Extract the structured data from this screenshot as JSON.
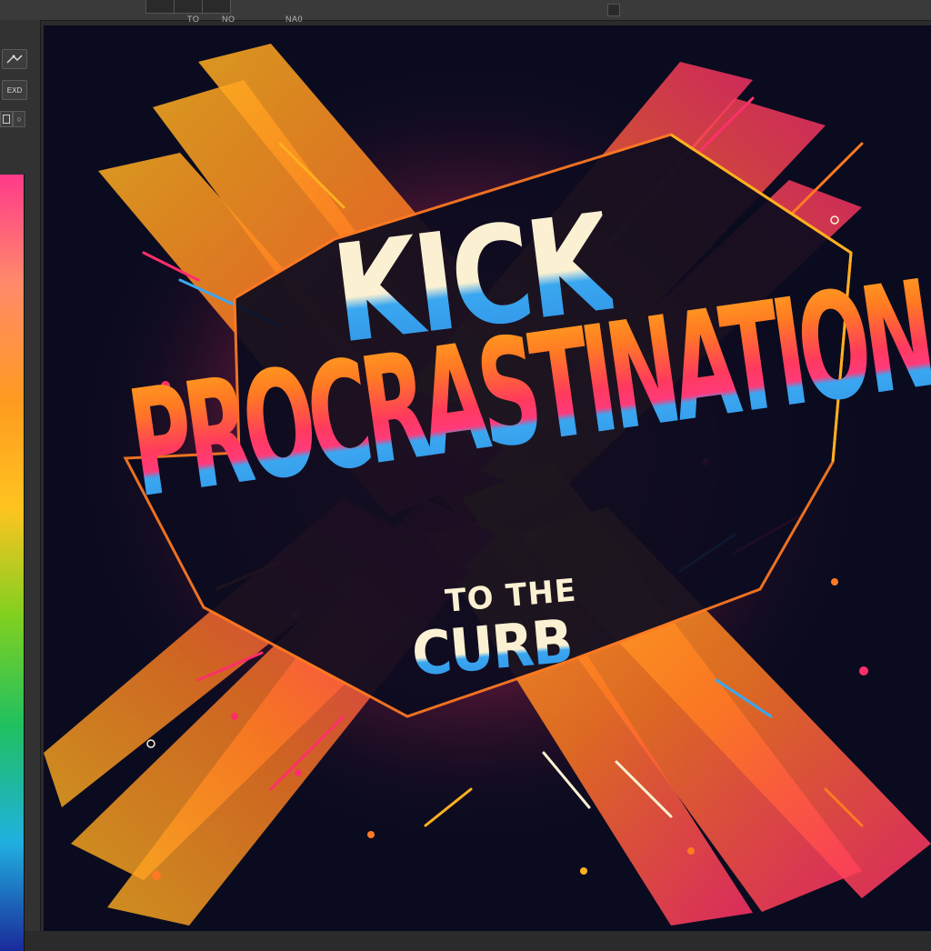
{
  "toolbar": {
    "label_a": "TO",
    "label_b": "NO",
    "label_c": "NA0"
  },
  "tools": {
    "expand_label": "EXD",
    "circle_glyph": "○"
  },
  "icons": {
    "path_tool": "pen-path-icon",
    "rect_mini": "rectangle-icon",
    "circle_mini": "circle-icon"
  },
  "artwork": {
    "line1": "KICK",
    "line2": "PROCRASTINATION",
    "line3": "TO THE",
    "line4": "CURB"
  },
  "palette": {
    "background": "#0b0b1f",
    "orange": "#ff7a22",
    "yellow": "#ffb020",
    "pink": "#ff2f6a",
    "blue": "#3aa7f0",
    "cream": "#fbf1d2"
  },
  "swatches": [
    "#ff3a8a",
    "#ff8a6a",
    "#ff9a20",
    "#ffc420",
    "#7fd020",
    "#20c060",
    "#20b0e0",
    "#1a2a9a"
  ]
}
